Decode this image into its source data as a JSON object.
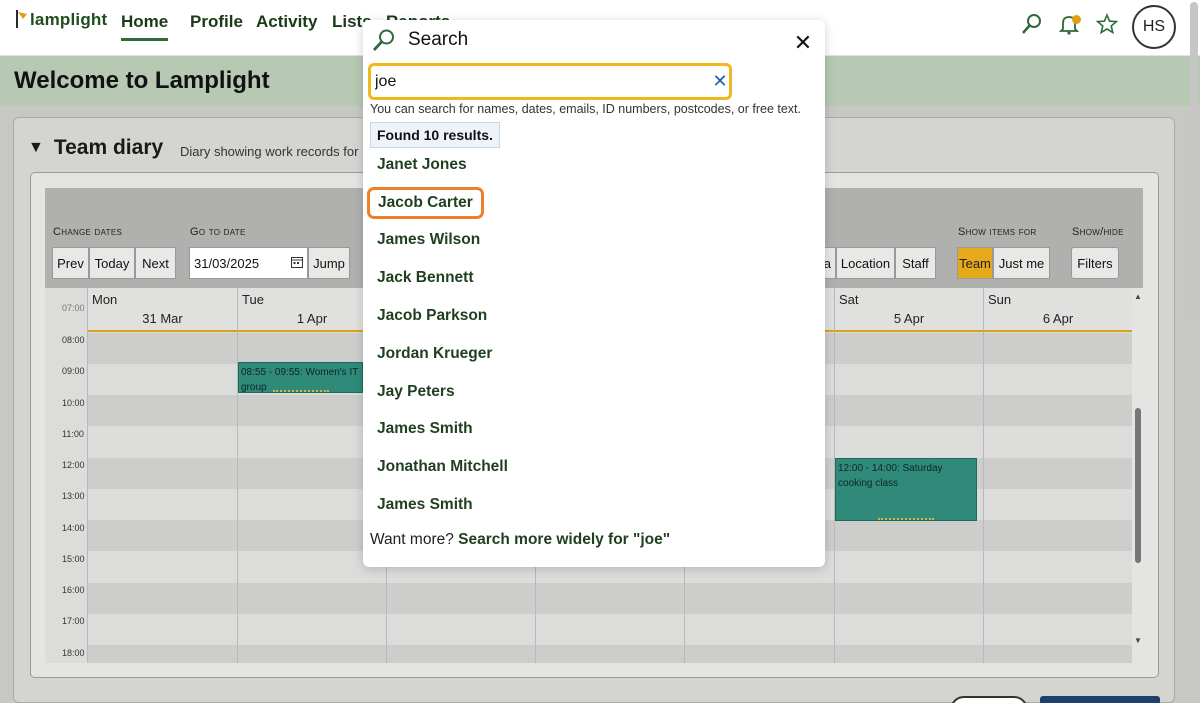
{
  "app": {
    "logo_text": "lamplight",
    "avatar_initials": "HS"
  },
  "nav": {
    "items": [
      {
        "label": "Home",
        "active": true
      },
      {
        "label": "Profile"
      },
      {
        "label": "Activity"
      },
      {
        "label": "Lists"
      },
      {
        "label": "Reports"
      }
    ],
    "icons": [
      "search-icon",
      "bell-icon",
      "star-icon"
    ]
  },
  "page": {
    "title": "Welcome to Lamplight"
  },
  "diary": {
    "title": "Team diary",
    "subtitle": "Diary showing work records for",
    "toolbar": {
      "change_dates_label": "Change dates",
      "prev": "Prev",
      "today": "Today",
      "next": "Next",
      "go_to_date_label": "Go to date",
      "date_value": "31/03/2025",
      "jump": "Jump",
      "partial_button": "a",
      "location": "Location",
      "staff": "Staff",
      "show_items_label": "Show items for",
      "team": "Team",
      "just_me": "Just me",
      "show_hide_label": "Show/hide",
      "filters": "Filters"
    },
    "days": [
      {
        "name": "Mon",
        "date": "31 Mar"
      },
      {
        "name": "Tue",
        "date": "1 Apr"
      },
      {
        "name": "Sat",
        "date": "5 Apr"
      },
      {
        "name": "Sun",
        "date": "6 Apr"
      }
    ],
    "times": [
      "07:00",
      "08:00",
      "09:00",
      "10:00",
      "11:00",
      "12:00",
      "13:00",
      "14:00",
      "15:00",
      "16:00",
      "17:00",
      "18:00"
    ],
    "events": [
      {
        "text": "08:55 - 09:55: Women's IT group"
      },
      {
        "text": "12:00 - 14:00: Saturday cooking class"
      }
    ]
  },
  "search": {
    "title": "Search",
    "query": "joe",
    "hint": "You can search for names, dates, emails, ID numbers, postcodes, or free text.",
    "found": "Found 10 results.",
    "results": [
      "Janet Jones",
      "Jacob Carter",
      "James Wilson",
      "Jack Bennett",
      "Jacob Parkson",
      "Jordan Krueger",
      "Jay Peters",
      "James Smith",
      "Jonathan Mitchell",
      "James Smith"
    ],
    "highlighted_index": 1,
    "more_prefix": "Want more?",
    "more_link": "Search more widely for \"joe\""
  },
  "colors": {
    "accent": "#f0b81e",
    "highlight": "#f07f2a",
    "event": "#2f8a7a",
    "brand_green": "#1f4d1f"
  }
}
